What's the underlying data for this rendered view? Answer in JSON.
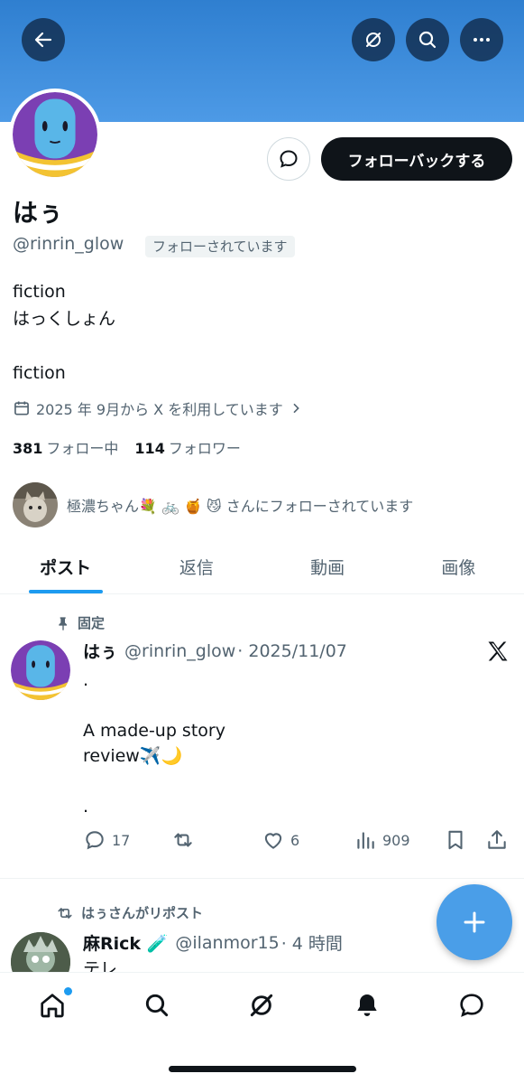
{
  "header": {
    "back_icon": "arrow-left-icon",
    "grok_icon": "grok-icon",
    "search_icon": "search-icon",
    "more_icon": "more-icon",
    "banner_color": "#3d8ddd"
  },
  "profile": {
    "display_name": "はぅ",
    "handle": "@rinrin_glow",
    "follows_you_badge": "フォローされています",
    "bio_lines": [
      "fiction",
      "はっくしょん",
      "",
      "fiction"
    ],
    "joined_text": "2025 年 9月から X を利用しています",
    "following_count": "381",
    "following_label": "フォロー中",
    "followers_count": "114",
    "followers_label": "フォロワー",
    "followed_by_text": "極濃ちゃん💐 🚲 🍯 😼 さんにフォローされています",
    "followback_button": "フォローバックする"
  },
  "tabs": [
    {
      "label": "ポスト",
      "active": true
    },
    {
      "label": "返信",
      "active": false
    },
    {
      "label": "動画",
      "active": false
    },
    {
      "label": "画像",
      "active": false
    }
  ],
  "pinned_post": {
    "pinned_label": "固定",
    "author_name": "はぅ",
    "author_handle": "@rinrin_glow",
    "date": "· 2025/11/07",
    "text_lines": [
      ".",
      "",
      "A made-up story",
      "review✈️🌙",
      "",
      "."
    ],
    "replies": "17",
    "reposts": "",
    "likes": "6",
    "views": "909"
  },
  "repost": {
    "reposted_by": "はぅさんがリポスト",
    "author_name": "麻Rick 🧪",
    "author_handle": "@ilanmor15",
    "time": "· 4 時間",
    "text": "テレ"
  },
  "bottom_nav": [
    "home-icon",
    "search-icon",
    "grok-icon",
    "notifications-icon",
    "messages-icon"
  ],
  "colors": {
    "accent": "#1d9bf0",
    "fab": "#4a9ee8",
    "text_primary": "#0f1419",
    "text_secondary": "#536471"
  }
}
